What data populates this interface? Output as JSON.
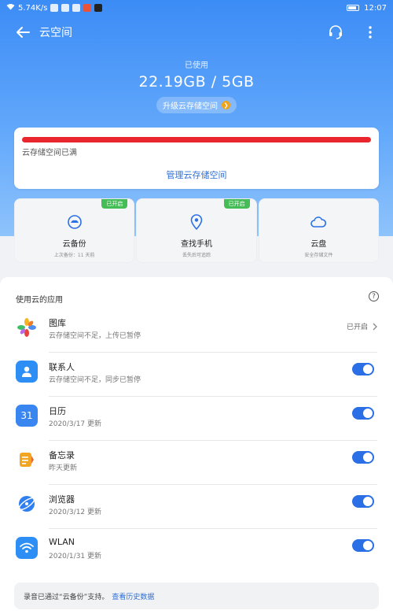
{
  "status_bar": {
    "network_speed": "5.74K/s",
    "time": "12:07"
  },
  "app_bar": {
    "title": "云空间"
  },
  "usage": {
    "label": "已使用",
    "value": "22.19GB / 5GB"
  },
  "upgrade": {
    "label": "升级云存储空间"
  },
  "storage": {
    "full_text": "云存储空间已满",
    "manage_label": "管理云存储空间",
    "bar_color": "#e9262d"
  },
  "features": [
    {
      "title": "云备份",
      "sub": "上次备份：11 天前",
      "badge": "已开启",
      "icon": "cloud-backup-icon"
    },
    {
      "title": "查找手机",
      "sub": "丢失后可追踪",
      "badge": "已开启",
      "icon": "location-pin-icon"
    },
    {
      "title": "云盘",
      "sub": "安全存储文件",
      "badge": "",
      "icon": "cloud-drive-icon"
    }
  ],
  "apps": {
    "header": "使用云的应用",
    "items": [
      {
        "name": "图库",
        "sub": "云存储空间不足，上传已暂停",
        "status": "已开启",
        "icon": "gallery-icon"
      },
      {
        "name": "联系人",
        "sub": "云存储空间不足，同步已暂停",
        "icon": "contacts-icon",
        "toggle_on": true
      },
      {
        "name": "日历",
        "sub": "2020/3/17 更新",
        "icon": "calendar-icon",
        "icon_text": "31",
        "toggle_on": true
      },
      {
        "name": "备忘录",
        "sub": "昨天更新",
        "icon": "notepad-icon",
        "toggle_on": true
      },
      {
        "name": "浏览器",
        "sub": "2020/3/12 更新",
        "icon": "browser-icon",
        "toggle_on": true
      },
      {
        "name": "WLAN",
        "sub": "2020/1/31 更新",
        "icon": "wifi-icon",
        "toggle_on": true
      }
    ]
  },
  "note": {
    "text": "录音已通过“云备份”支持。",
    "link": "查看历史数据"
  },
  "colors": {
    "accent": "#2a6fe6",
    "hero_top": "#3c8cf6",
    "badge_green": "#45bd57"
  }
}
